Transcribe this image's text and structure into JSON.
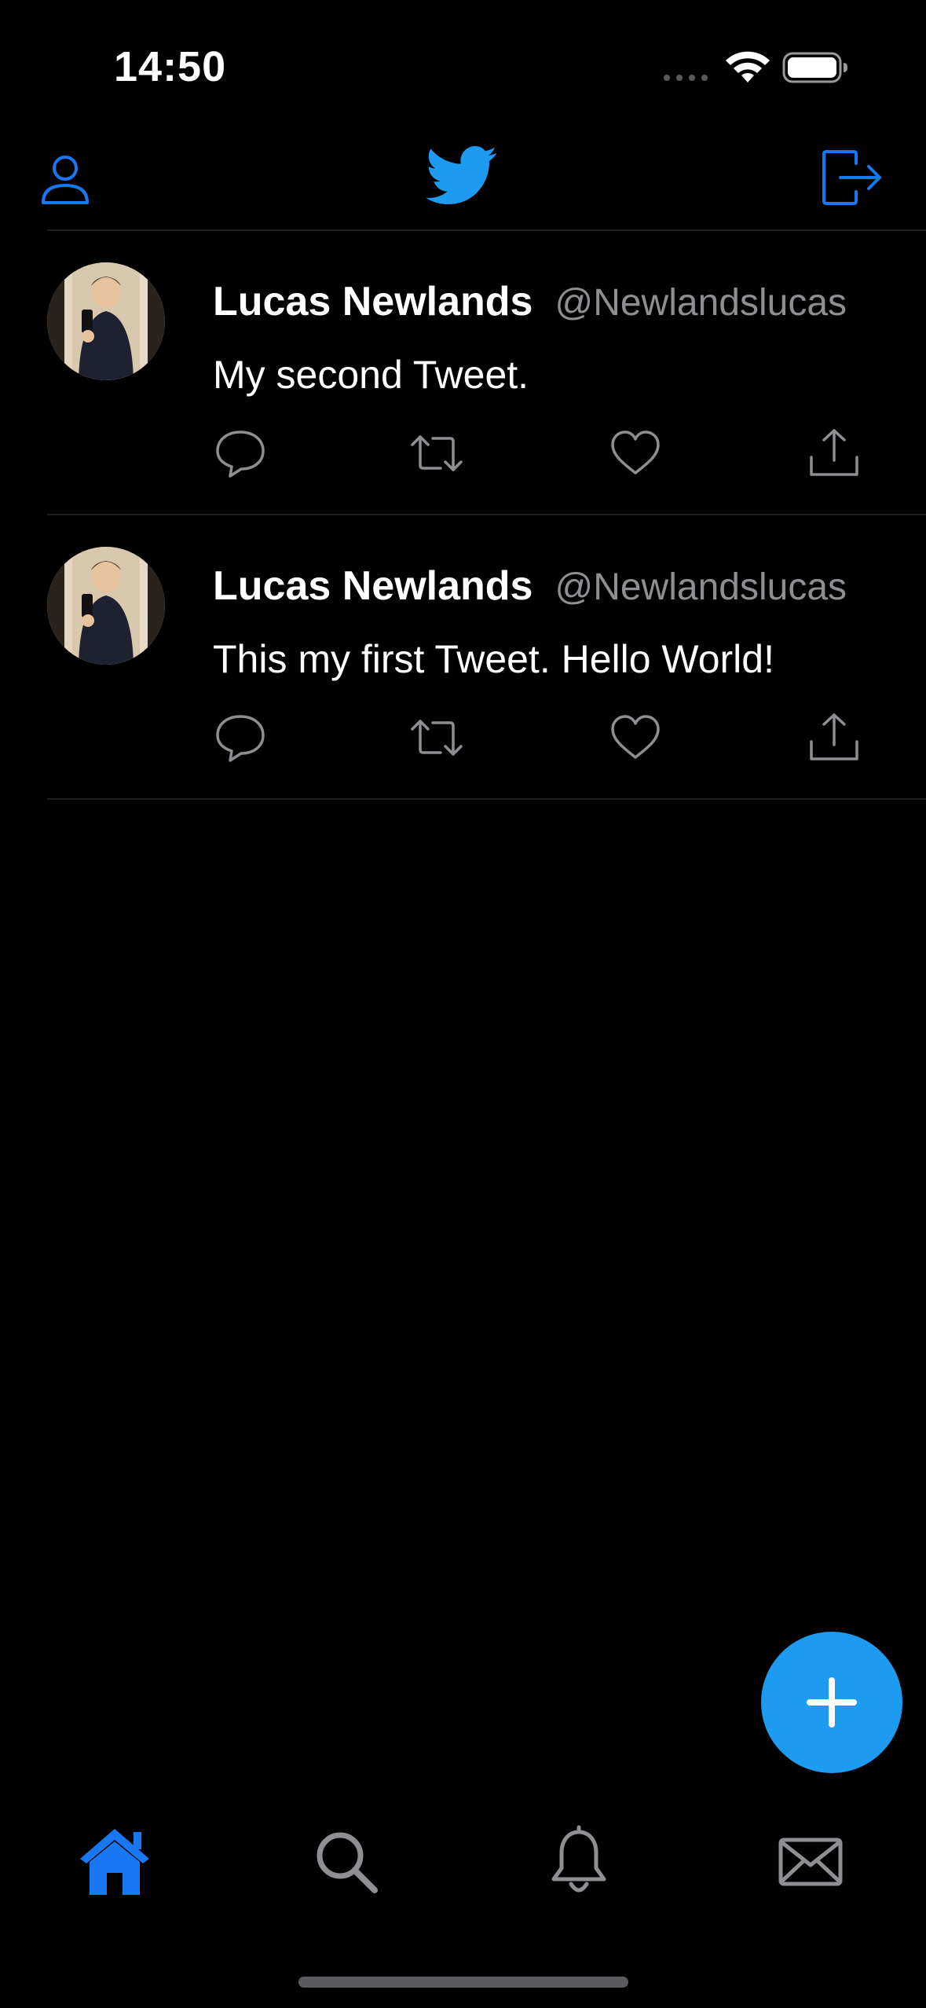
{
  "status_bar": {
    "time": "14:50"
  },
  "nav": {
    "profile_icon": "person-icon",
    "logo_icon": "twitter-bird-icon",
    "logout_icon": "logout-icon"
  },
  "tweets": [
    {
      "name": "Lucas Newlands",
      "handle": "@Newlandslucas",
      "text": "My second Tweet."
    },
    {
      "name": "Lucas Newlands",
      "handle": "@Newlandslucas",
      "text": "This my first Tweet. Hello World!"
    }
  ],
  "actions": [
    "reply-icon",
    "retweet-icon",
    "like-icon",
    "share-icon"
  ],
  "fab": {
    "icon": "plus-icon"
  },
  "tabs": [
    {
      "icon": "home-icon",
      "selected": true
    },
    {
      "icon": "search-icon",
      "selected": false
    },
    {
      "icon": "bell-icon",
      "selected": false
    },
    {
      "icon": "envelope-icon",
      "selected": false
    }
  ],
  "colors": {
    "background": "#000000",
    "accent": "#1d9bf0",
    "tab_active": "#1877f2",
    "secondary_text": "#8e8e93",
    "icon_gray": "#8e8e93"
  }
}
